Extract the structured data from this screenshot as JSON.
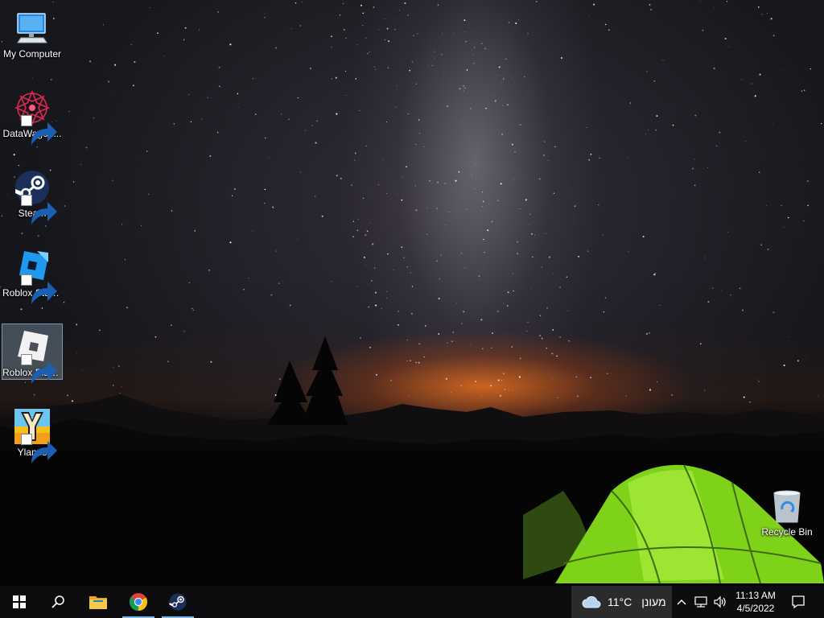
{
  "desktop": {
    "icons": [
      {
        "label": "My Computer",
        "icon": "monitor-icon",
        "shortcut": false
      },
      {
        "label": "DataWagon...",
        "icon": "datawagon-icon",
        "shortcut": true
      },
      {
        "label": "Steam",
        "icon": "steam-icon",
        "shortcut": true
      },
      {
        "label": "Roblox Studio",
        "icon": "roblox-studio-icon",
        "shortcut": true
      },
      {
        "label": "Roblox Player",
        "icon": "roblox-player-icon",
        "shortcut": true,
        "selected": true
      },
      {
        "label": "Ylands",
        "icon": "ylands-icon",
        "shortcut": true
      }
    ],
    "recycle_bin": {
      "label": "Recycle Bin",
      "icon": "recycle-bin-icon"
    }
  },
  "taskbar": {
    "pinned": [
      {
        "name": "File Explorer",
        "icon": "folder-icon",
        "running": false
      },
      {
        "name": "Google Chrome",
        "icon": "chrome-icon",
        "running": true
      },
      {
        "name": "Steam",
        "icon": "steam-icon",
        "running": true
      }
    ],
    "weather": {
      "temperature": "11°C",
      "condition": "מעונן",
      "icon": "cloud-icon"
    },
    "clock": {
      "time": "11:13 AM",
      "date": "4/5/2022"
    }
  },
  "colors": {
    "taskbar": "#0d0d0f",
    "weather_widget": "#2b2b2e",
    "running_indicator": "#76b9ed",
    "selection": "#96b4d2"
  }
}
